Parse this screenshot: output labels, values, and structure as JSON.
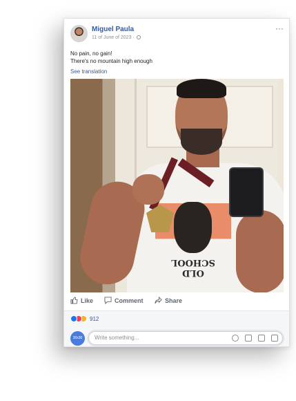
{
  "post": {
    "author": "Miguel Paula",
    "date": "11 of June of 2023",
    "separator": "·",
    "more_icon": "···",
    "text_line1": "No pain, no gain!",
    "text_line2": "There's no mountain high enough",
    "translate_link": "See translation",
    "photo_text": "OLD SCHOOL"
  },
  "actions": {
    "like": "Like",
    "comment": "Comment",
    "share": "Share"
  },
  "reactions": {
    "count": "912",
    "icons": [
      "like-icon",
      "love-icon",
      "haha-icon"
    ]
  },
  "comment": {
    "avatar_text": "30x30",
    "placeholder": "Write something..."
  },
  "colors": {
    "link": "#385898",
    "like": "#1877f2",
    "love": "#f33e58",
    "haha": "#f7b125"
  }
}
